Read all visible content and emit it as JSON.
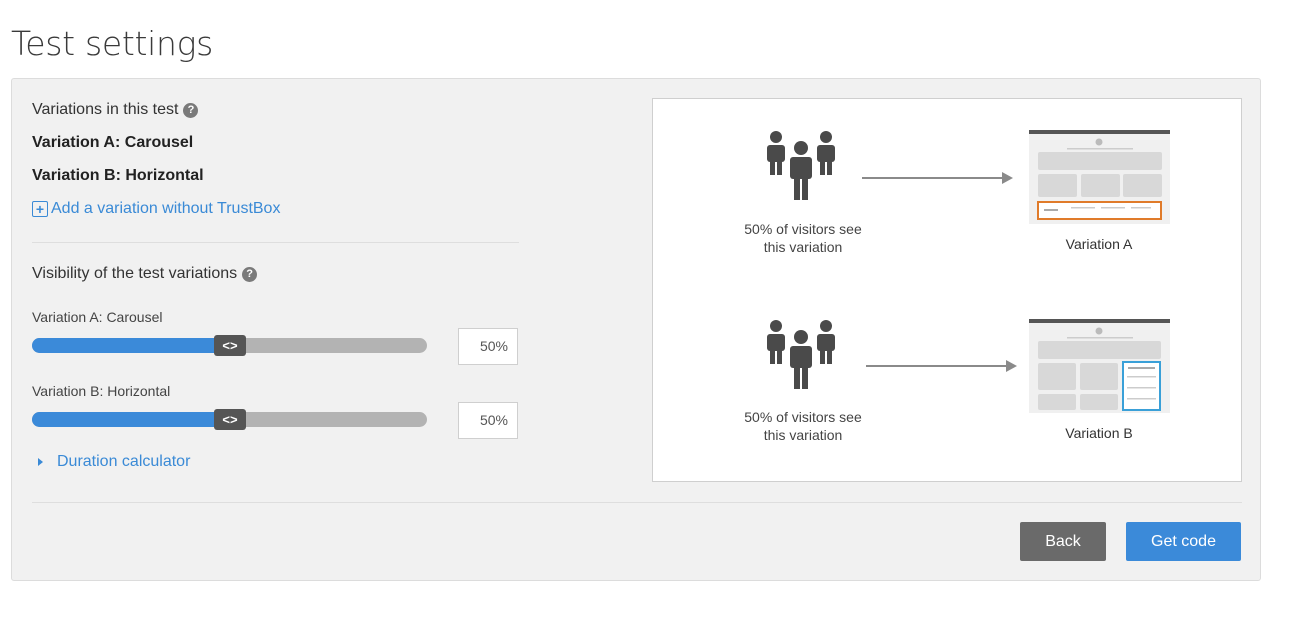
{
  "page": {
    "title": "Test settings"
  },
  "variations": {
    "heading": "Variations in this test",
    "help": "?",
    "items": [
      "Variation A: Carousel",
      "Variation B: Horizontal"
    ],
    "add_link": "Add a variation without TrustBox"
  },
  "visibility": {
    "heading": "Visibility of the test variations",
    "help": "?",
    "sliders": [
      {
        "label": "Variation A: Carousel",
        "value": "50%",
        "fraction": 0.5
      },
      {
        "label": "Variation B: Horizontal",
        "value": "50%",
        "fraction": 0.5
      }
    ],
    "handle_glyph": "<>"
  },
  "duration": {
    "label": "Duration calculator"
  },
  "preview": {
    "rows": [
      {
        "visitors_line1": "50% of visitors see",
        "visitors_line2": "this variation",
        "caption": "Variation A",
        "highlight": "#e07b2a"
      },
      {
        "visitors_line1": "50% of visitors see",
        "visitors_line2": "this variation",
        "caption": "Variation B",
        "highlight": "#3aa0d8"
      }
    ]
  },
  "actions": {
    "back": "Back",
    "get_code": "Get code"
  },
  "colors": {
    "accent": "#3b8ad9",
    "back_button": "#6a6a6a"
  }
}
